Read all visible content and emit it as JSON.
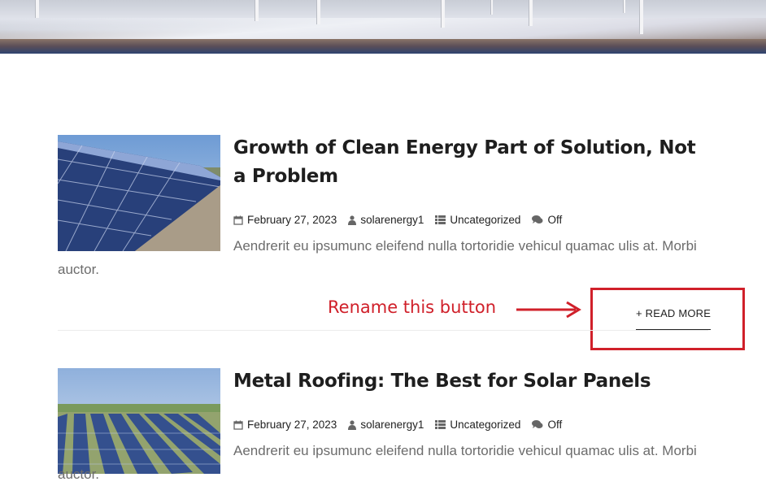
{
  "posts": [
    {
      "title": "Growth of Clean Energy Part of Solution, Not a Problem",
      "date": "February 27, 2023",
      "author": "solarenergy1",
      "category": "Uncategorized",
      "comments": "Off",
      "excerpt": "Aendrerit eu ipsumunc eleifend nulla tortoridie vehicul quamac ulis at. Morbi auctor.",
      "read_more": "+ READ MORE"
    },
    {
      "title": "Metal Roofing: The Best for Solar Panels",
      "date": "February 27, 2023",
      "author": "solarenergy1",
      "category": "Uncategorized",
      "comments": "Off",
      "excerpt": "Aendrerit eu ipsumunc eleifend nulla tortoridie vehicul quamac ulis at. Morbi auctor."
    }
  ],
  "annotation": {
    "text": "Rename this button",
    "color": "#d0202a"
  },
  "icons": [
    "calendar-icon",
    "user-icon",
    "list-icon",
    "comments-icon"
  ]
}
